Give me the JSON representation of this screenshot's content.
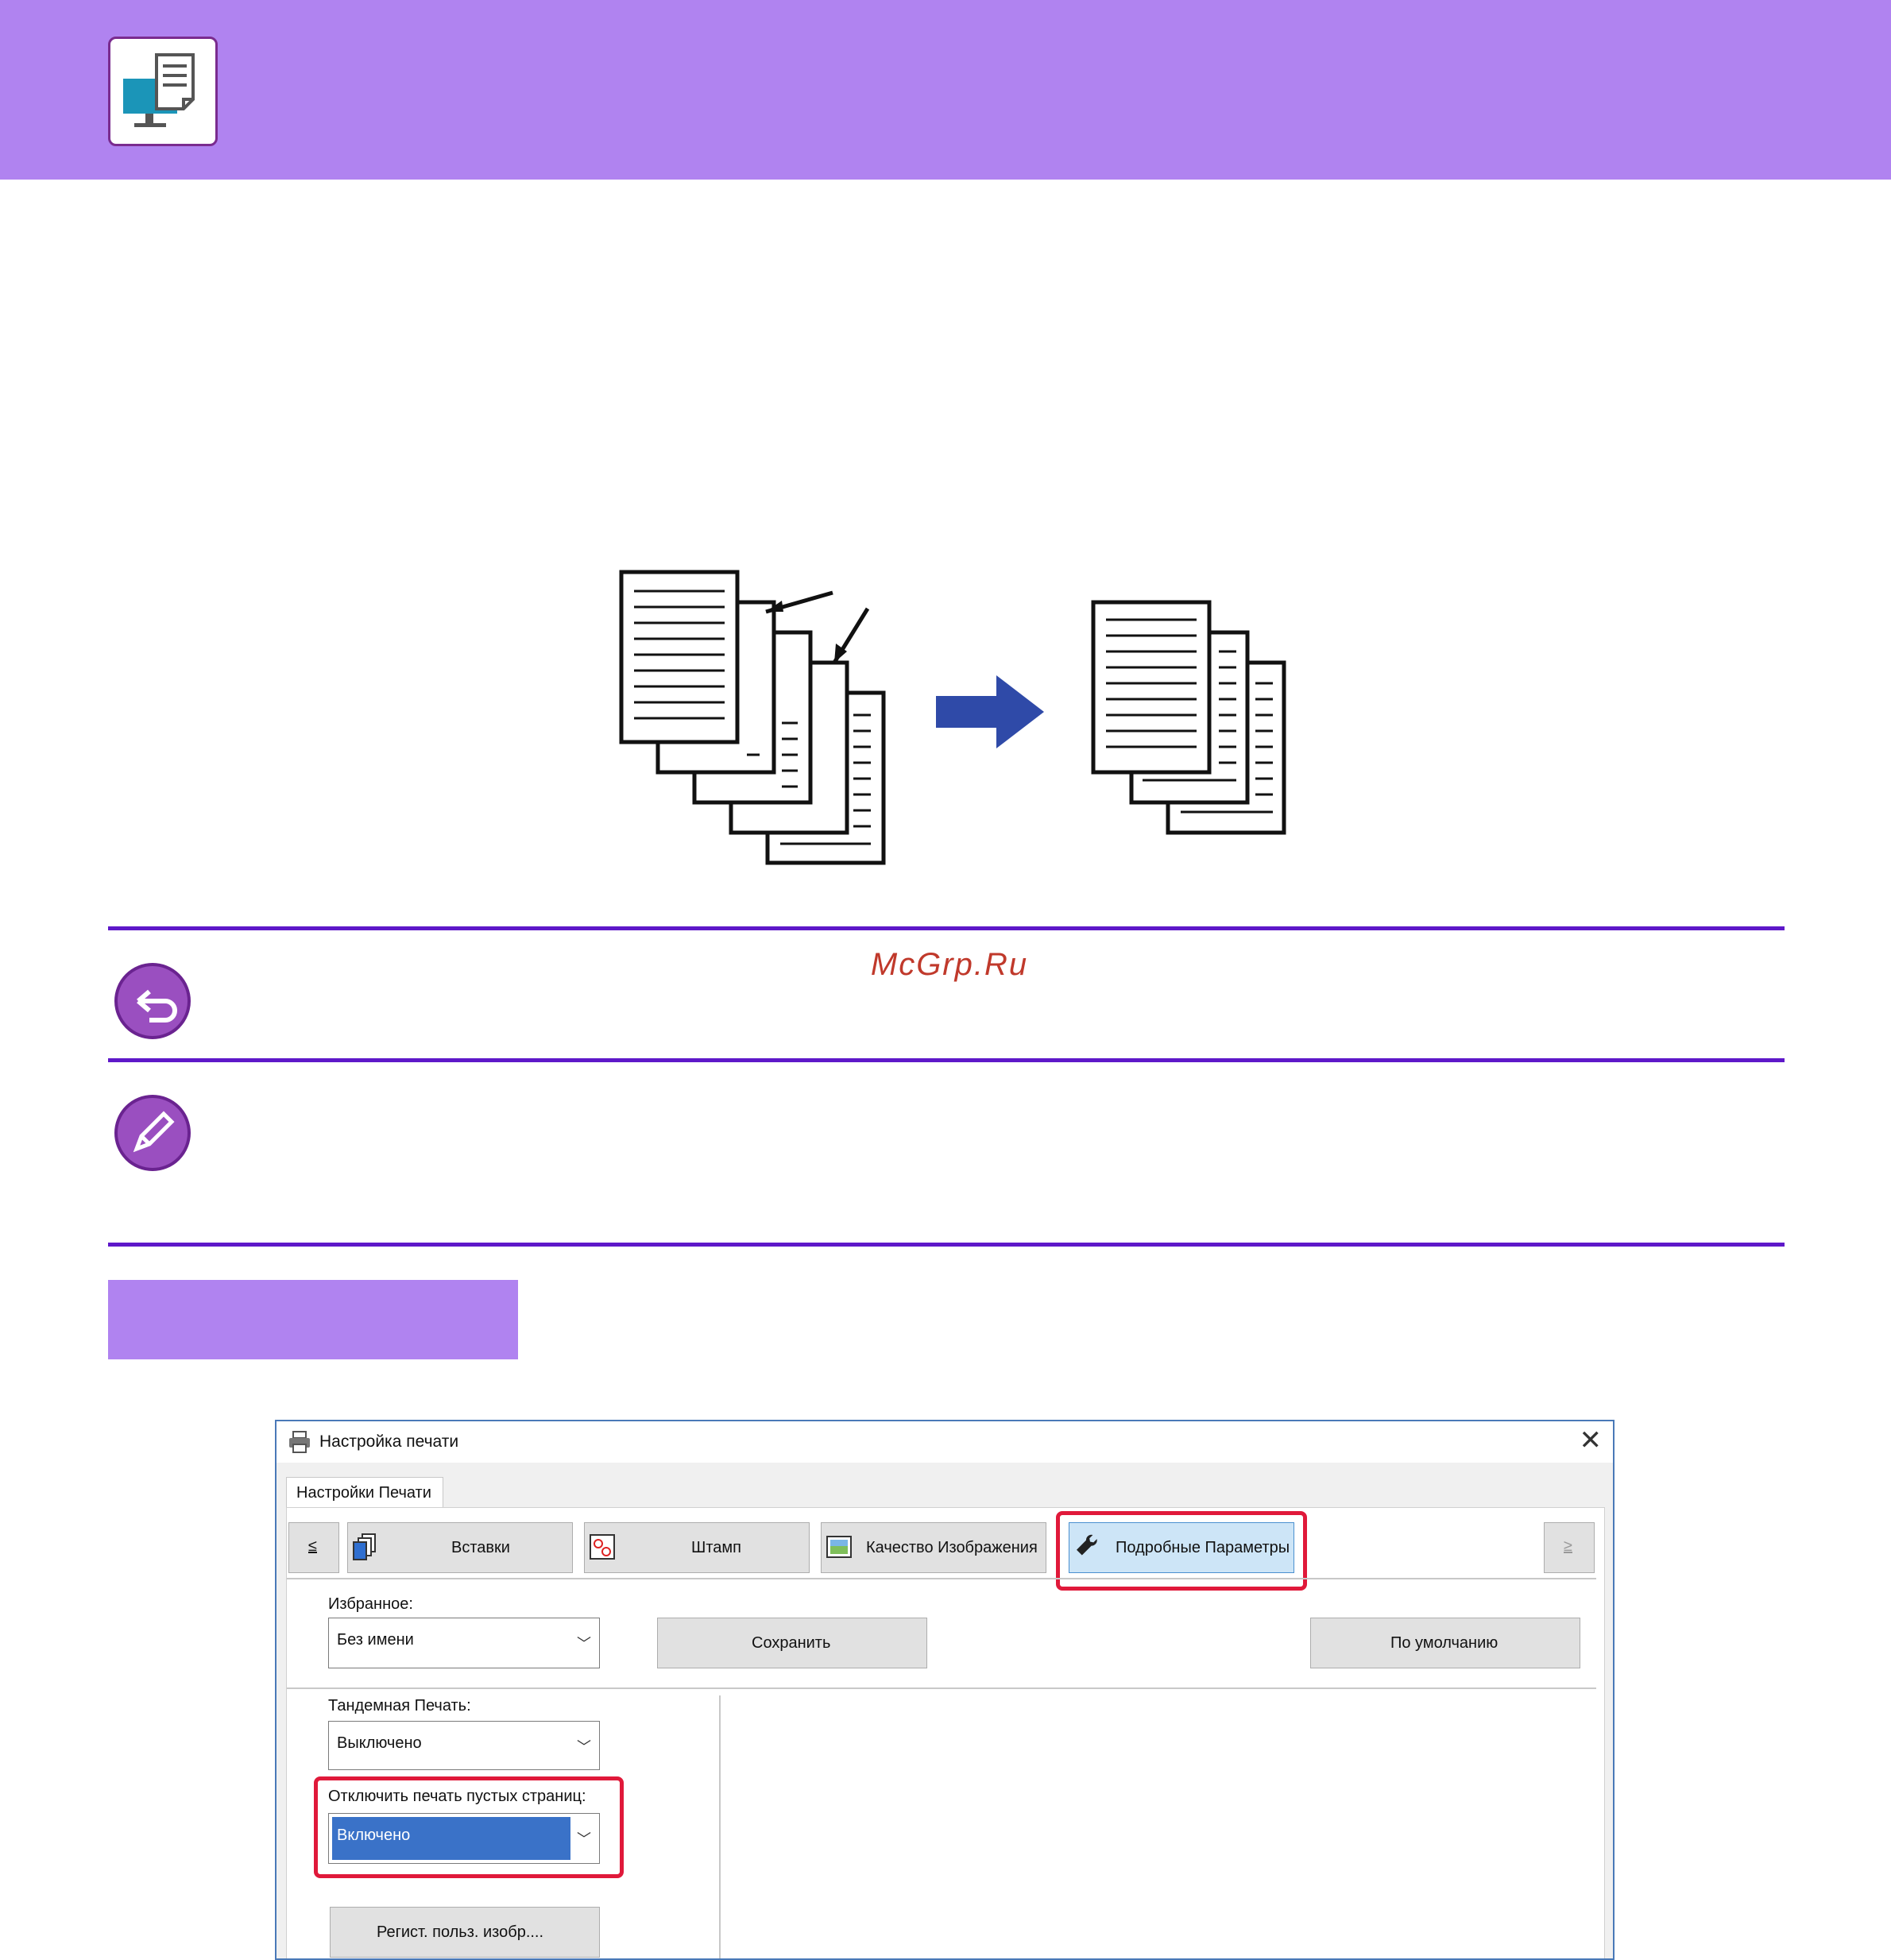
{
  "watermark": "McGrp.Ru",
  "colors": {
    "header": "#b083f0",
    "rule": "#5e18c9",
    "icon_circle": "#9a4fc0",
    "highlight": "#e0193a",
    "arrow": "#2f4aa8",
    "selected_item": "#3a72c8"
  },
  "icons": {
    "header": "monitor-document-icon",
    "note_back": "back-arrow-icon",
    "note_pencil": "pencil-icon"
  },
  "dialog": {
    "title": "Настройка печати",
    "close_glyph": "✕",
    "tab_main": "Настройки Печати",
    "nav_prev": "≤",
    "nav_next": "≥",
    "tabs": [
      {
        "label": "Вставки"
      },
      {
        "label": "Штамп"
      },
      {
        "label": "Качество Изображения"
      },
      {
        "label": "Подробные Параметры"
      }
    ],
    "favorites_label": "Избранное:",
    "favorites_value": "Без имени",
    "save_button": "Сохранить",
    "default_button": "По умолчанию",
    "tandem_label": "Тандемная Печать:",
    "tandem_value": "Выключено",
    "blank_pages_label": "Отключить печать пустых страниц:",
    "blank_pages_value": "Включено",
    "register_button": "Регист. польз. изобр...."
  }
}
